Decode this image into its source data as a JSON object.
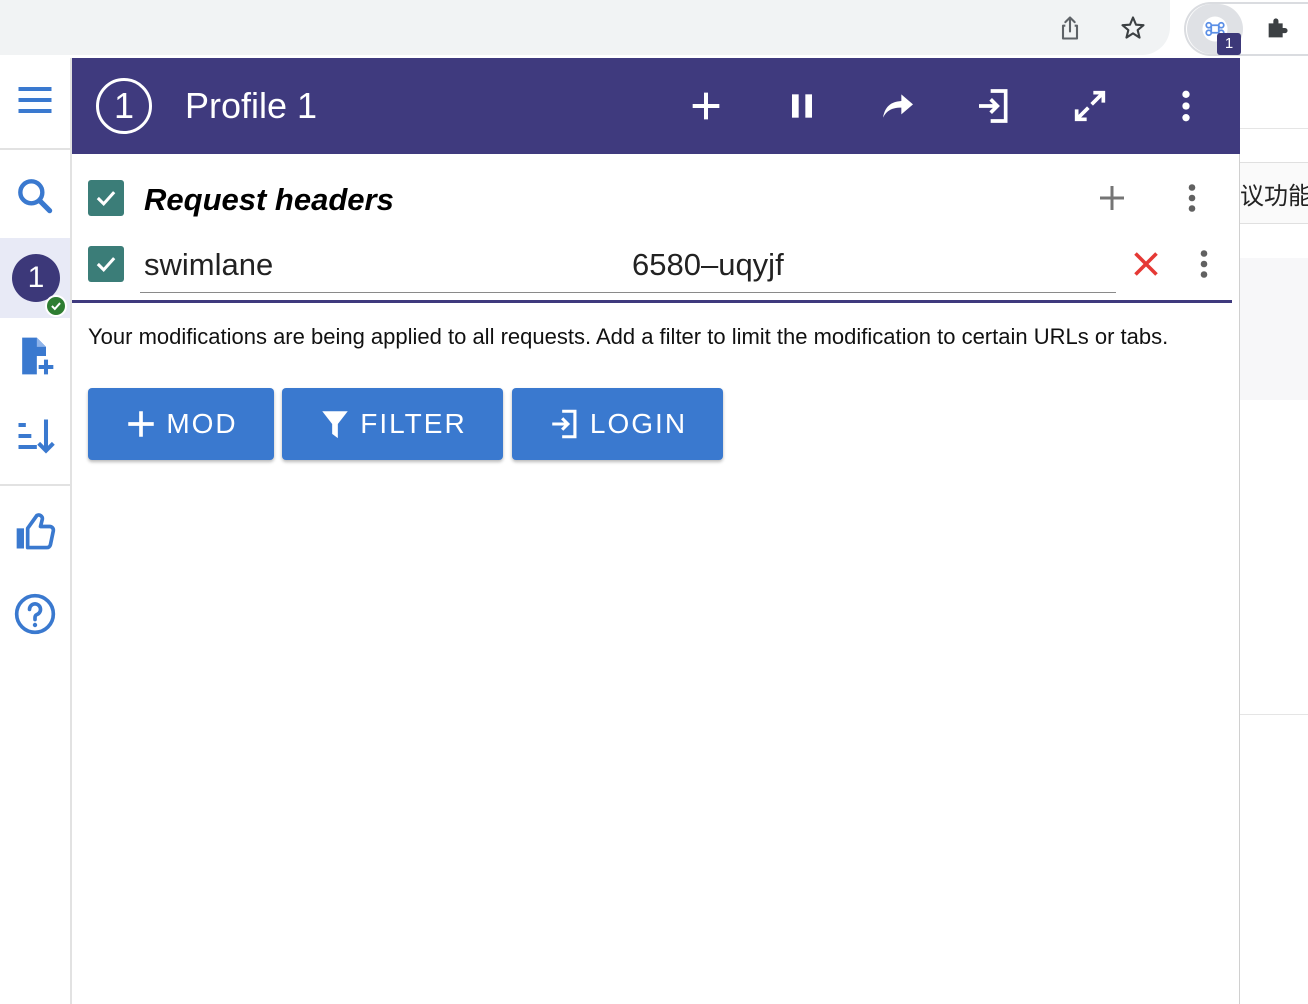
{
  "colors": {
    "header_bg": "#3f3a7e",
    "accent_blue": "#3a79cf",
    "checkbox_teal": "#3b7d78",
    "delete_red": "#e53935",
    "status_green": "#2e7d32"
  },
  "browser": {
    "extension_badge": "1",
    "toolbar_icons": [
      "share-icon",
      "star-icon",
      "modheader-extension-icon",
      "puzzle-extensions-icon"
    ]
  },
  "background_page": {
    "snippet_text": "议功能"
  },
  "sidebar": {
    "profile_badge": "1",
    "icons": [
      "menu-icon",
      "search-icon",
      "profile-icon",
      "add-file-icon",
      "sort-icon",
      "thumbs-up-icon",
      "help-icon"
    ]
  },
  "header": {
    "profile_number": "1",
    "title": "Profile 1",
    "icons": [
      "add-icon",
      "pause-icon",
      "share-arrow-icon",
      "login-icon",
      "expand-icon",
      "more-vert-icon"
    ]
  },
  "request_headers": {
    "title": "Request headers",
    "enabled": true,
    "rows": [
      {
        "enabled": true,
        "name": "swimlane",
        "value": "6580–uqyjf"
      }
    ]
  },
  "info_text": "Your modifications are being applied to all requests. Add a filter to limit the modification to certain URLs or tabs.",
  "actions": {
    "mod_label": "MOD",
    "filter_label": "FILTER",
    "login_label": "LOGIN"
  }
}
